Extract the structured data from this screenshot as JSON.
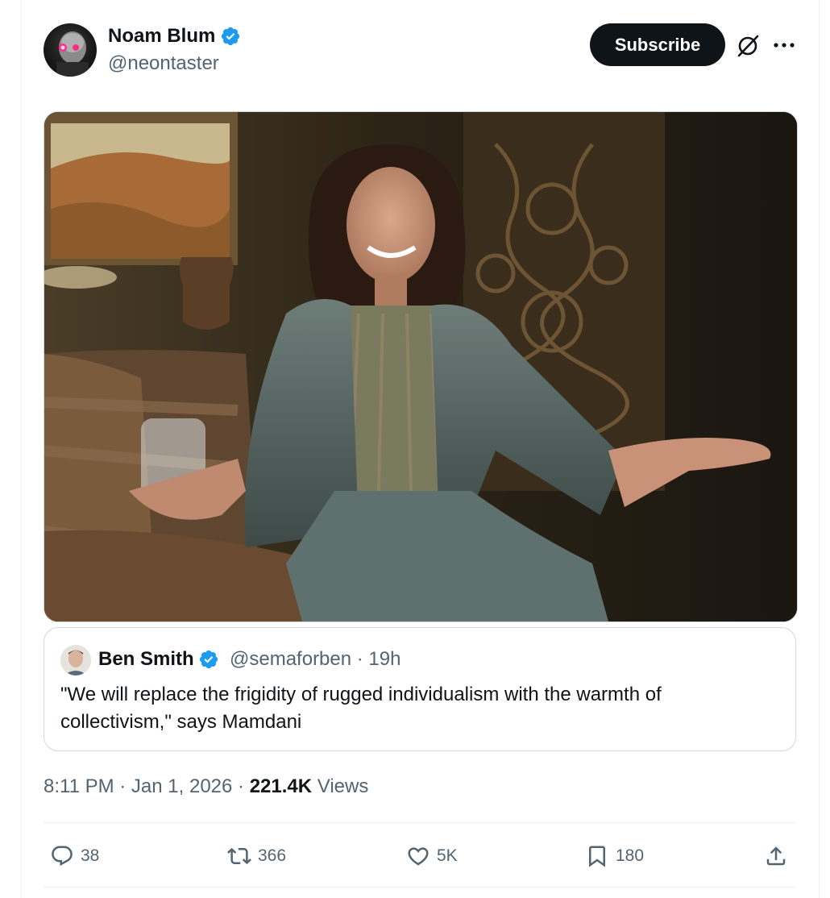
{
  "author": {
    "display_name": "Noam Blum",
    "handle": "@neontaster",
    "verified": true
  },
  "header": {
    "subscribe_label": "Subscribe",
    "grok_icon": "grok-icon",
    "more_icon": "more-icon"
  },
  "quoted_post": {
    "display_name": "Ben Smith",
    "handle_time": "@semaforben · 19h",
    "text": "\"We will replace the frigidity of rugged individualism with the warmth of collectivism,\" says Mamdani"
  },
  "meta": {
    "time_date": "8:11 PM · Jan 1, 2026 · ",
    "views_count": "221.4K",
    "views_label": " Views"
  },
  "actions": {
    "replies": "38",
    "reposts": "366",
    "likes": "5K",
    "bookmarks": "180"
  },
  "colors": {
    "verified": "#1d9bf0",
    "secondary_text": "#536471",
    "primary_text": "#0f1419"
  }
}
